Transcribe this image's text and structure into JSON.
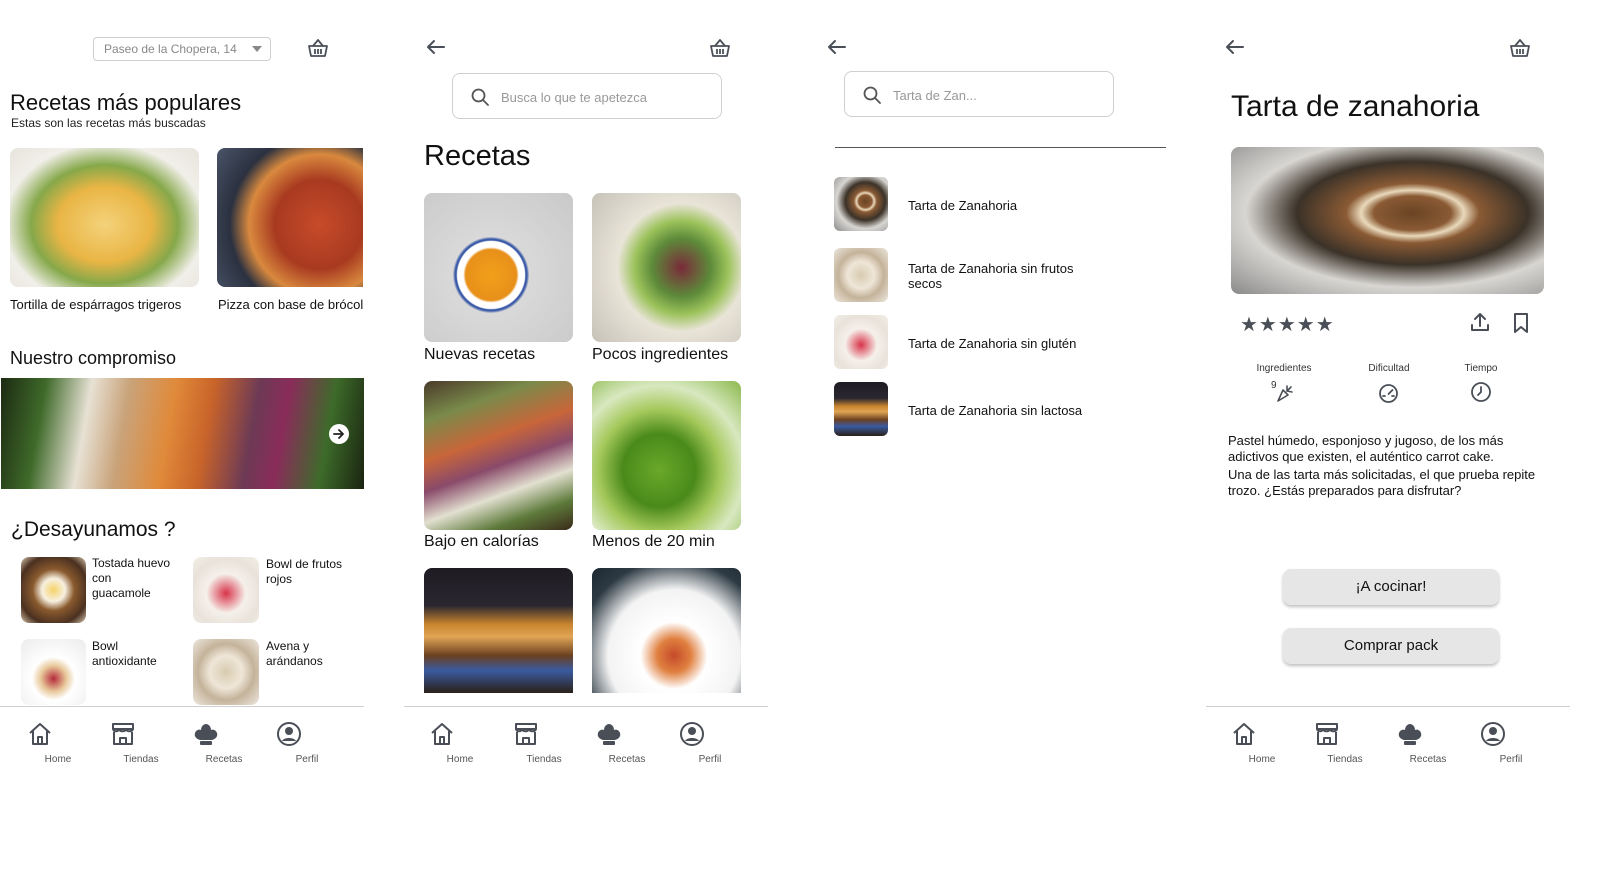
{
  "screen_home": {
    "address_select": "Paseo de la Chopera, 14",
    "popular_title": "Recetas más populares",
    "popular_subtitle": "Estas son las recetas más buscadas",
    "popular_items": [
      {
        "label": "Tortilla de espárragos trigeros"
      },
      {
        "label": "Pizza con base de brócol"
      }
    ],
    "commitment_title": "Nuestro compromiso",
    "breakfast_title": "¿Desayunamos ?",
    "breakfast_items": [
      {
        "label": "Tostada huevo con guacamole"
      },
      {
        "label": "Bowl de frutos rojos"
      },
      {
        "label": "Bowl antioxidante"
      },
      {
        "label": "Avena y arándanos"
      }
    ]
  },
  "screen_recipes": {
    "search_placeholder": "Busca lo que te apetezca",
    "title": "Recetas",
    "categories": [
      {
        "label": "Nuevas recetas"
      },
      {
        "label": "Pocos ingredientes"
      },
      {
        "label": "Bajo en calorías"
      },
      {
        "label": "Menos de 20 min"
      },
      {
        "label": ""
      },
      {
        "label": ""
      }
    ]
  },
  "screen_search": {
    "search_placeholder": "Tarta de Zan...",
    "results": [
      {
        "label": "Tarta de Zanahoria"
      },
      {
        "label": "Tarta de Zanahoria sin frutos secos"
      },
      {
        "label": "Tarta de Zanahoria sin glutén"
      },
      {
        "label": "Tarta de Zanahoria sin lactosa"
      }
    ]
  },
  "screen_detail": {
    "title": "Tarta de zanahoria",
    "rating": 5,
    "stars_text": "★★★★★",
    "ingredients_label": "Ingredientes",
    "ingredients_count": "9",
    "difficulty_label": "Dificultad",
    "time_label": "Tiempo",
    "description_1": "Pastel húmedo, esponjoso y jugoso, de los más adictivos que existen, el auténtico carrot cake.",
    "description_2": "Una de las tarta más solicitadas, el que prueba repite trozo. ¿Estás preparados para disfrutar?",
    "cook_button": "¡A cocinar!",
    "buy_button": "Comprar pack"
  },
  "nav": {
    "home": "Home",
    "stores": "Tiendas",
    "recipes": "Recetas",
    "profile": "Perfil"
  },
  "colors": {
    "icon": "#4a4f57",
    "border": "#cfcfcf",
    "button_bg": "#e6e6e6"
  }
}
